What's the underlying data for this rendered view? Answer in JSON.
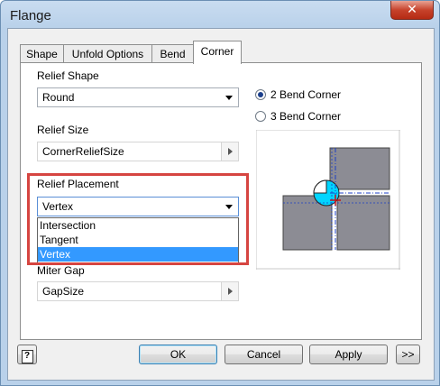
{
  "window": {
    "title": "Flange",
    "close_glyph": "✕"
  },
  "tabs": [
    {
      "label": "Shape"
    },
    {
      "label": "Unfold Options"
    },
    {
      "label": "Bend"
    },
    {
      "label": "Corner",
      "active": true
    }
  ],
  "corner": {
    "relief_shape": {
      "label": "Relief Shape",
      "value": "Round"
    },
    "relief_size": {
      "label": "Relief Size",
      "value": "CornerReliefSize"
    },
    "relief_placement": {
      "label": "Relief Placement",
      "value": "Vertex",
      "options": [
        "Intersection",
        "Tangent",
        "Vertex"
      ],
      "selected_option": "Vertex"
    },
    "miter_gap": {
      "label": "Miter Gap",
      "value": "GapSize"
    },
    "radio_options": [
      {
        "label": "2 Bend Corner",
        "checked": true
      },
      {
        "label": "3 Bend Corner",
        "checked": false
      }
    ]
  },
  "footer": {
    "help_glyph": "?",
    "ok": "OK",
    "cancel": "Cancel",
    "apply": "Apply",
    "more": ">>"
  },
  "colors": {
    "highlight": "#d64541",
    "selection": "#3399ff",
    "preview_fill": "#8c8c94",
    "relief_fill": "#00d5ff"
  }
}
